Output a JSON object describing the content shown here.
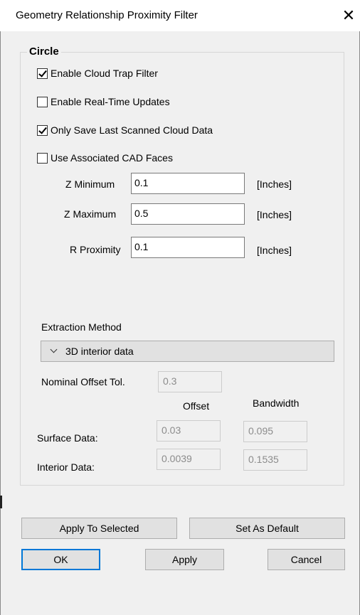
{
  "window": {
    "title": "Geometry Relationship Proximity Filter",
    "close_glyph": "✕"
  },
  "group": {
    "title": "Circle",
    "checkboxes": [
      {
        "label": "Enable Cloud Trap Filter",
        "checked": true
      },
      {
        "label": "Enable Real-Time Updates",
        "checked": false
      },
      {
        "label": "Only Save Last Scanned Cloud Data",
        "checked": true
      },
      {
        "label": "Use Associated CAD Faces",
        "checked": false
      }
    ],
    "fields": [
      {
        "label": "Z Minimum",
        "value": "0.1",
        "unit": "[Inches]"
      },
      {
        "label": "Z Maximum",
        "value": "0.5",
        "unit": "[Inches]"
      },
      {
        "label": "R Proximity",
        "value": "0.1",
        "unit": "[Inches]"
      }
    ],
    "extraction": {
      "label": "Extraction Method",
      "selected": "3D interior data"
    },
    "nominal": {
      "label": "Nominal Offset  Tol.",
      "value": "0.3"
    },
    "columns": {
      "offset": "Offset",
      "bandwidth": "Bandwidth"
    },
    "rows": [
      {
        "label": "Surface Data:",
        "offset": "0.03",
        "bandwidth": "0.095"
      },
      {
        "label": "Interior Data:",
        "offset": "0.0039",
        "bandwidth": "0.1535"
      }
    ]
  },
  "buttons": {
    "apply_to_selected": "Apply To Selected",
    "set_as_default": "Set As Default",
    "ok": "OK",
    "apply": "Apply",
    "cancel": "Cancel"
  },
  "colors": {
    "background": "#f0f0f0",
    "default_button_border": "#0078d7"
  }
}
